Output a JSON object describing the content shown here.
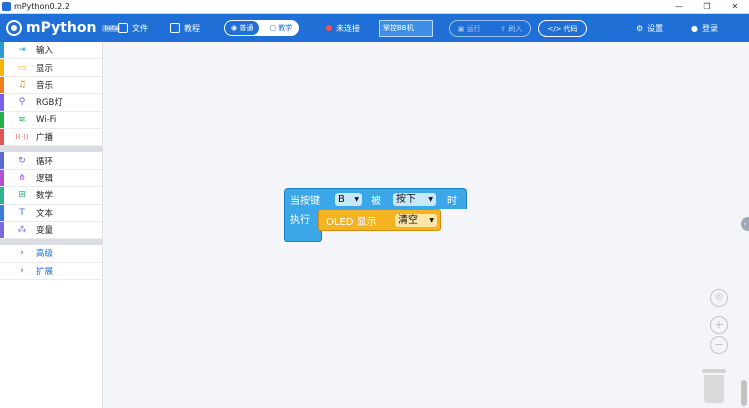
{
  "window": {
    "title": "mPython0.2.2"
  },
  "toolbar": {
    "logo": "mPython",
    "logo_badge": "beta",
    "file": "文件",
    "tutorial": "教程",
    "mode_normal": "普通",
    "mode_teach": "教学",
    "connection": "未连接",
    "device": "掌控BB机",
    "run": "运行",
    "flash": "刷入",
    "code": "代码",
    "settings": "设置",
    "login": "登录"
  },
  "sidebar": {
    "groups": [
      [
        {
          "label": "输入",
          "color": "#2a9bd8"
        },
        {
          "label": "显示",
          "color": "#f5b400"
        },
        {
          "label": "音乐",
          "color": "#f07d1a"
        },
        {
          "label": "RGB灯",
          "color": "#7a5cf0"
        },
        {
          "label": "Wi-Fi",
          "color": "#23b04b"
        },
        {
          "label": "广播",
          "color": "#e05656"
        }
      ],
      [
        {
          "label": "循环",
          "color": "#5b6bd6"
        },
        {
          "label": "逻辑",
          "color": "#b44fd6"
        },
        {
          "label": "数学",
          "color": "#2fb38c"
        },
        {
          "label": "文本",
          "color": "#3b7bd9"
        },
        {
          "label": "变量",
          "color": "#7f6ae0"
        }
      ]
    ],
    "advanced": "高级",
    "extend": "扩展"
  },
  "blocks": {
    "event_prefix": "当按键",
    "button_value": "B",
    "event_mid": "被",
    "action_value": "按下",
    "event_suffix": "时",
    "exec_label": "执行",
    "oled_label": "OLED 显示",
    "oled_value": "清空"
  }
}
